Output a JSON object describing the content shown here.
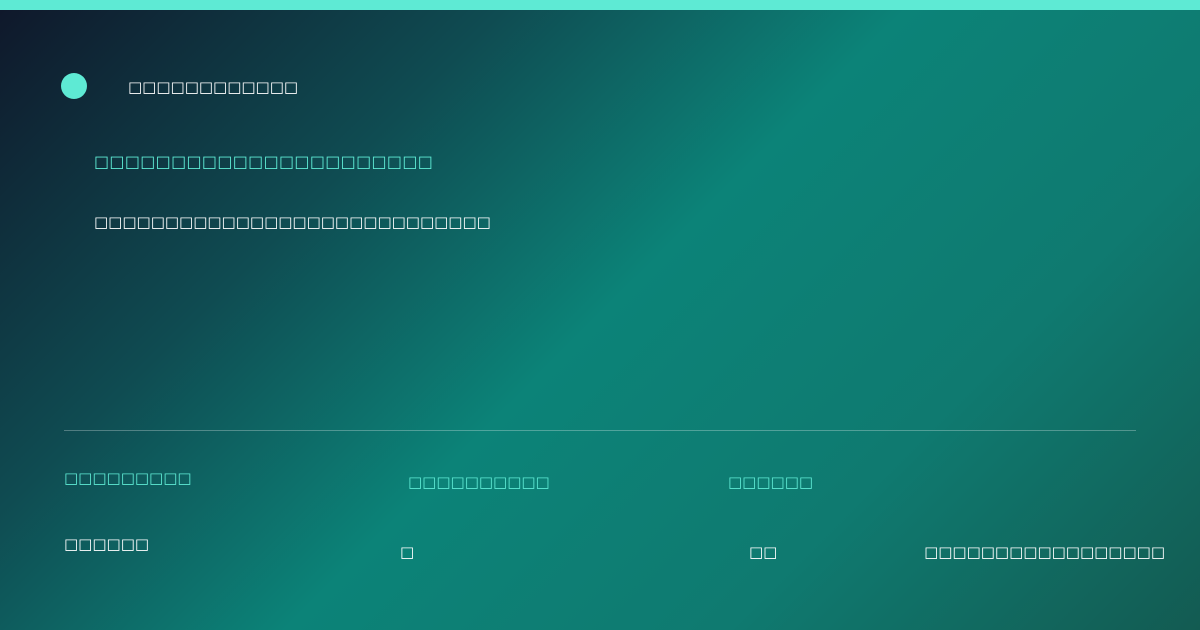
{
  "accent_color": "#5eead4",
  "header": {
    "brand_name": "□□□□□□□□□□□□"
  },
  "hero": {
    "headline": "□□□□□□□□□□□□□□□□□□□□□□",
    "subline": "□□□□□□□□□□□□□□□□□□□□□□□□□□□□"
  },
  "footer": {
    "labels": [
      "□□□□□□□□□",
      "□□□□□□□□□□",
      "□□□□□□"
    ],
    "values": [
      "□□□□□□",
      "□",
      "□□",
      "□□□□□□□□□□□□□□□□□"
    ]
  }
}
